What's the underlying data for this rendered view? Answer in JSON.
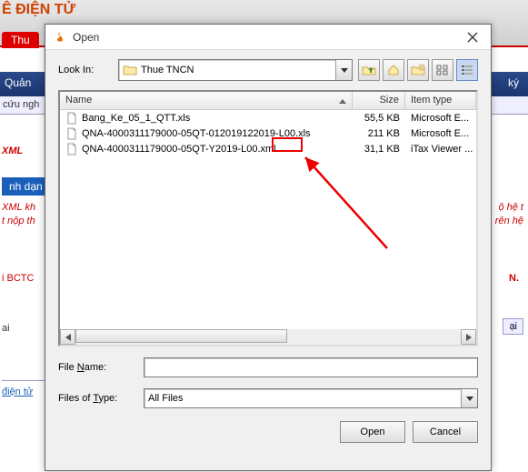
{
  "background": {
    "title_fragment": "Ê ĐIỆN TỬ",
    "red_tab": "Thu",
    "nav_left": "Quản",
    "nav_right": "ký",
    "subnav_left": "cứu ngh",
    "xml_label": "XML",
    "section_heading": "nh dạn",
    "red_line1": "XML kh",
    "red_line2": "t nộp th",
    "red_right1": "ộ hệ t",
    "red_right2": "rên hệ",
    "red_line3": "i BCTC",
    "red_right3": "N.",
    "label_ai": "ai",
    "btn_ai": "ại",
    "link_dientu": "điện tử"
  },
  "dialog": {
    "title": "Open",
    "lookin_label": "Look In:",
    "lookin_value": "Thue TNCN",
    "columns": {
      "name": "Name",
      "size": "Size",
      "type": "Item type"
    },
    "files": [
      {
        "name": "Bang_Ke_05_1_QTT.xls",
        "size": "55,5 KB",
        "type": "Microsoft E..."
      },
      {
        "name": "QNA-4000311179000-05QT-012019122019-L00.xls",
        "size": "211 KB",
        "type": "Microsoft E..."
      },
      {
        "name": "QNA-4000311179000-05QT-Y2019-L00.xml",
        "size": "31,1 KB",
        "type": "iTax Viewer ..."
      }
    ],
    "filename_label": "File Name:",
    "filename_value": "",
    "filetype_label": "Files of Type:",
    "filetype_value": "All Files",
    "open_btn": "Open",
    "cancel_btn": "Cancel"
  },
  "icons": {
    "up": "up-folder-icon",
    "home": "home-icon",
    "newfolder": "new-folder-icon",
    "list": "list-view-icon",
    "details": "details-view-icon"
  }
}
